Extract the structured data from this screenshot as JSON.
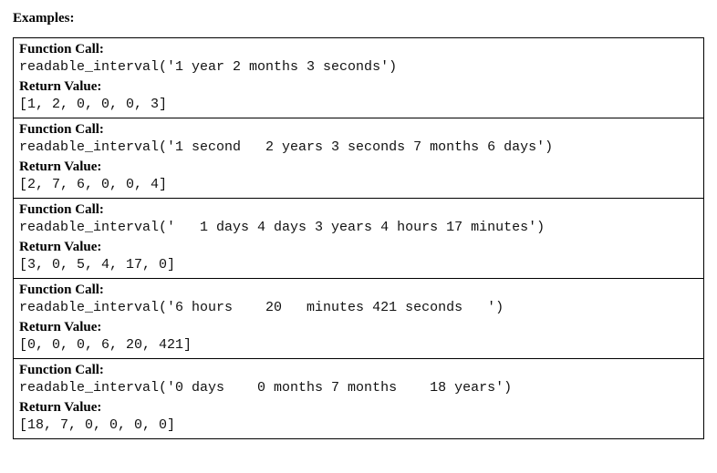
{
  "heading": "Examples:",
  "labels": {
    "call": "Function Call:",
    "ret": "Return Value:"
  },
  "rows": [
    {
      "call": "readable_interval('1 year 2 months 3 seconds')",
      "ret": "[1, 2, 0, 0, 0, 3]"
    },
    {
      "call": "readable_interval('1 second   2 years 3 seconds 7 months 6 days')",
      "ret": "[2, 7, 6, 0, 0, 4]"
    },
    {
      "call": "readable_interval('   1 days 4 days 3 years 4 hours 17 minutes')",
      "ret": "[3, 0, 5, 4, 17, 0]"
    },
    {
      "call": "readable_interval('6 hours    20   minutes 421 seconds   ')",
      "ret": "[0, 0, 0, 6, 20, 421]"
    },
    {
      "call": "readable_interval('0 days    0 months 7 months    18 years')",
      "ret": "[18, 7, 0, 0, 0, 0]"
    }
  ]
}
